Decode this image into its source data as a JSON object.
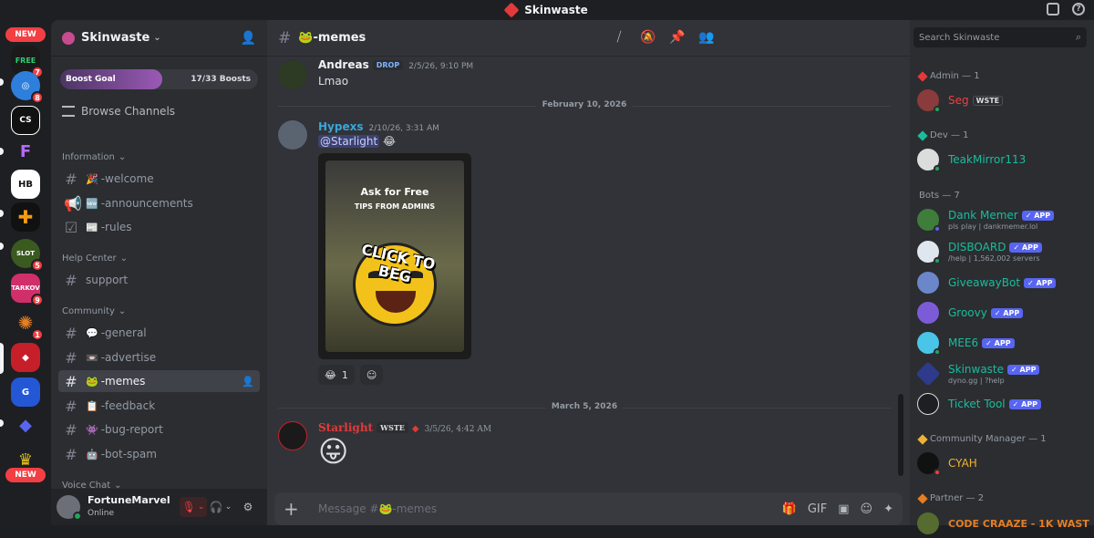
{
  "app": {
    "title": "Skinwaste"
  },
  "rail": {
    "new_top": "NEW",
    "new_bottom": "NEW",
    "servers": [
      {
        "name": "server-1",
        "badge": "7",
        "color": "#1a1a1a"
      },
      {
        "name": "server-2",
        "badge": "8",
        "color": "#2e7fdc"
      },
      {
        "name": "server-3",
        "badge": "",
        "color": "#111111"
      },
      {
        "name": "server-4",
        "badge": "",
        "color": "#1e1f22"
      },
      {
        "name": "server-5",
        "badge": "",
        "color": "#ffffff"
      },
      {
        "name": "server-6",
        "badge": "",
        "color": "#111111"
      },
      {
        "name": "server-7",
        "badge": "5",
        "color": "#3a5a20"
      },
      {
        "name": "server-8",
        "badge": "9",
        "color": "#d12f6a"
      },
      {
        "name": "server-9",
        "badge": "1",
        "color": "#1e1f22"
      },
      {
        "name": "skinwaste",
        "badge": "",
        "color": "#c61f2a"
      },
      {
        "name": "server-11",
        "badge": "",
        "color": "#2457d6"
      },
      {
        "name": "server-12",
        "badge": "",
        "color": "#1e1f22"
      },
      {
        "name": "server-13",
        "badge": "",
        "color": "#e4c21a"
      }
    ]
  },
  "sidebar": {
    "server_name": "Skinwaste",
    "boost_label": "Boost Goal",
    "boost_count": "17/33 Boosts",
    "boost_progress": 0.515,
    "browse": "Browse Channels",
    "categories": {
      "information": "Information",
      "help": "Help Center",
      "community": "Community",
      "voice": "Voice Chat"
    },
    "channels": {
      "welcome": {
        "emoji": "🎉",
        "name": "-welcome"
      },
      "announcements": {
        "emoji": "🆕",
        "name": "-announcements"
      },
      "rules": {
        "emoji": "📰",
        "name": "-rules"
      },
      "support": {
        "emoji": "",
        "name": "support"
      },
      "general": {
        "emoji": "💬",
        "name": "-general"
      },
      "advertise": {
        "emoji": "📼",
        "name": "-advertise"
      },
      "memes": {
        "emoji": "🐸",
        "name": "-memes"
      },
      "feedback": {
        "emoji": "📋",
        "name": "-feedback"
      },
      "bug_report": {
        "emoji": "👾",
        "name": "-bug-report"
      },
      "bot_spam": {
        "emoji": "🤖",
        "name": "-bot-spam"
      }
    },
    "user": {
      "name": "FortuneMarvel",
      "status": "Online"
    }
  },
  "chat": {
    "channel_emoji": "🐸",
    "channel_name": "-memes",
    "messages": {
      "andreas": {
        "author": "Andreas",
        "tag": "DROP",
        "time": "2/5/26, 9:10 PM",
        "text": "Lmao"
      },
      "hypexs": {
        "author": "Hypexs",
        "time": "2/10/26, 3:31 AM",
        "mention": "@Starlight",
        "emoji": "😂"
      },
      "starlight": {
        "author": "Starlight",
        "tag": "WSTE",
        "time": "3/5/26, 4:42 AM",
        "emoji": "😛"
      }
    },
    "dividers": {
      "first": "February 10, 2026",
      "second": "March 5, 2026"
    },
    "meme": {
      "line1": "Ask for Free",
      "line2": "TIPS FROM ADMINS",
      "line3": "CLICK TO BEG"
    },
    "reaction": {
      "emoji": "😂",
      "count": "1"
    },
    "composer_placeholder": "Message #🐸-memes"
  },
  "members": {
    "search_placeholder": "Search Skinwaste",
    "roles": {
      "admin": "Admin — 1",
      "dev": "Dev — 1",
      "bots": "Bots — 7",
      "community_manager": "Community Manager — 1",
      "partner": "Partner — 2"
    },
    "list": {
      "seg": {
        "name": "Seg",
        "tag": "WSTE",
        "color": "#f23f43"
      },
      "teak": {
        "name": "TeakMirror113",
        "color": "#1abc9c"
      },
      "dank": {
        "name": "Dank Memer",
        "sub": "pls play | dankmemer.lol",
        "app": "APP"
      },
      "disboard": {
        "name": "DISBOARD",
        "sub": "/help | 1,562,002 servers",
        "app": "APP"
      },
      "giveaway": {
        "name": "GiveawayBot",
        "app": "APP"
      },
      "groovy": {
        "name": "Groovy",
        "app": "APP"
      },
      "mee6": {
        "name": "MEE6",
        "app": "APP"
      },
      "skinwaste": {
        "name": "Skinwaste",
        "sub": "dyno.gg | ?help",
        "app": "APP"
      },
      "ticket": {
        "name": "Ticket Tool",
        "app": "APP"
      },
      "cyah": {
        "name": "CYAH",
        "color": "#f0b232"
      },
      "codecraaze": {
        "name": "CODE CRAAZE - 1K WAST",
        "color": "#e67e22"
      }
    },
    "bot_color": "#1abc9c"
  }
}
